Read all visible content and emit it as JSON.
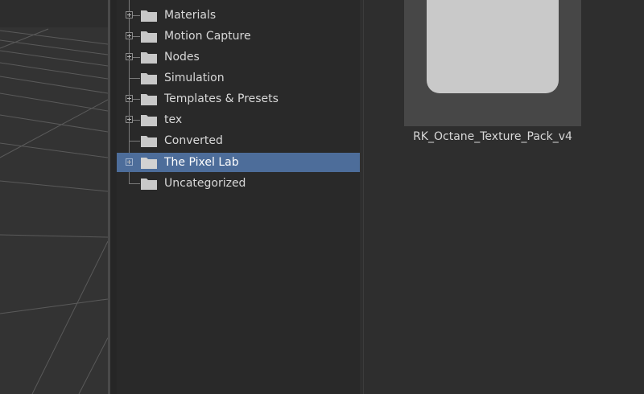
{
  "tree": {
    "items": [
      {
        "label": "Materials",
        "has_children": true,
        "selected": false
      },
      {
        "label": "Motion Capture",
        "has_children": true,
        "selected": false
      },
      {
        "label": "Nodes",
        "has_children": true,
        "selected": false
      },
      {
        "label": "Simulation",
        "has_children": false,
        "selected": false
      },
      {
        "label": "Templates & Presets",
        "has_children": true,
        "selected": false
      },
      {
        "label": "tex",
        "has_children": true,
        "selected": false
      },
      {
        "label": "Converted",
        "has_children": false,
        "selected": false
      },
      {
        "label": "The Pixel Lab",
        "has_children": true,
        "selected": true
      },
      {
        "label": "Uncategorized",
        "has_children": false,
        "selected": false
      }
    ]
  },
  "content": {
    "items": [
      {
        "label": "RK_Octane_Texture_Pack_v4",
        "icon": "folder-icon"
      }
    ]
  },
  "colors": {
    "selection": "#4d6d9a",
    "panel_bg": "#292929",
    "text": "#d8d8d8"
  }
}
